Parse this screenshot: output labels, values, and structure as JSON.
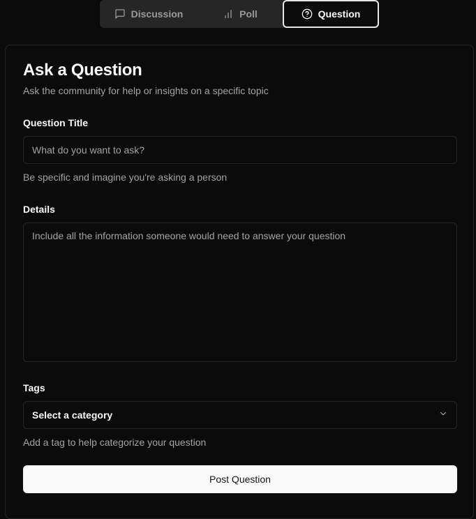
{
  "tabs": [
    {
      "label": "Discussion",
      "icon": "message-square-icon",
      "active": false
    },
    {
      "label": "Poll",
      "icon": "bar-chart-icon",
      "active": false
    },
    {
      "label": "Question",
      "icon": "help-circle-icon",
      "active": true
    }
  ],
  "form": {
    "title": "Ask a Question",
    "subtitle": "Ask the community for help or insights on a specific topic",
    "question_title": {
      "label": "Question Title",
      "placeholder": "What do you want to ask?",
      "value": "",
      "hint": "Be specific and imagine you're asking a person"
    },
    "details": {
      "label": "Details",
      "placeholder": "Include all the information someone would need to answer your question",
      "value": ""
    },
    "tags": {
      "label": "Tags",
      "selected": "Select a category",
      "icon": "chevron-down-icon",
      "hint": "Add a tag to help categorize your question"
    },
    "submit_label": "Post Question"
  },
  "colors": {
    "background": "#0b0b0b",
    "border": "#262626",
    "muted_text": "#a3a3a3",
    "primary_button": "#fafafa"
  }
}
